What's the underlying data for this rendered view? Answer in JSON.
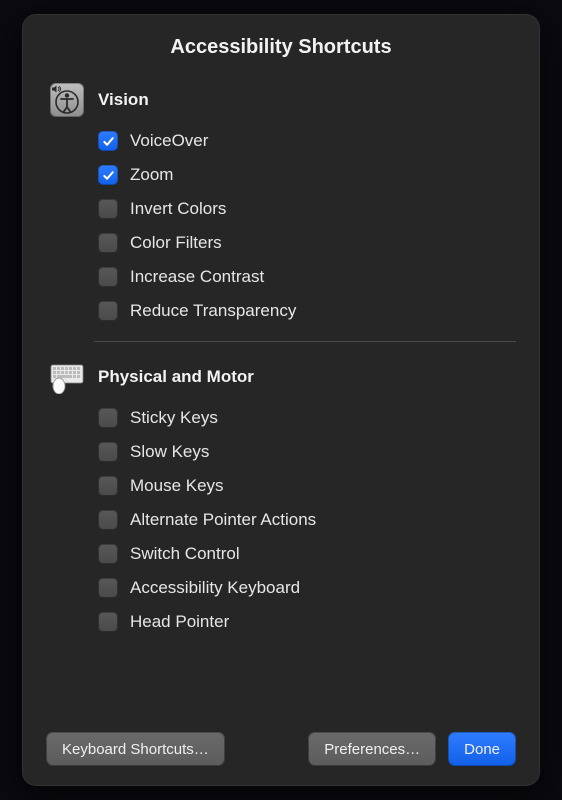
{
  "title": "Accessibility Shortcuts",
  "sections": {
    "vision": {
      "title": "Vision",
      "options": [
        {
          "label": "VoiceOver",
          "checked": true
        },
        {
          "label": "Zoom",
          "checked": true
        },
        {
          "label": "Invert Colors",
          "checked": false
        },
        {
          "label": "Color Filters",
          "checked": false
        },
        {
          "label": "Increase Contrast",
          "checked": false
        },
        {
          "label": "Reduce Transparency",
          "checked": false
        }
      ]
    },
    "physical": {
      "title": "Physical and Motor",
      "options": [
        {
          "label": "Sticky Keys",
          "checked": false
        },
        {
          "label": "Slow Keys",
          "checked": false
        },
        {
          "label": "Mouse Keys",
          "checked": false
        },
        {
          "label": "Alternate Pointer Actions",
          "checked": false
        },
        {
          "label": "Switch Control",
          "checked": false
        },
        {
          "label": "Accessibility Keyboard",
          "checked": false
        },
        {
          "label": "Head Pointer",
          "checked": false
        }
      ]
    }
  },
  "buttons": {
    "keyboard_shortcuts": "Keyboard Shortcuts…",
    "preferences": "Preferences…",
    "done": "Done"
  }
}
